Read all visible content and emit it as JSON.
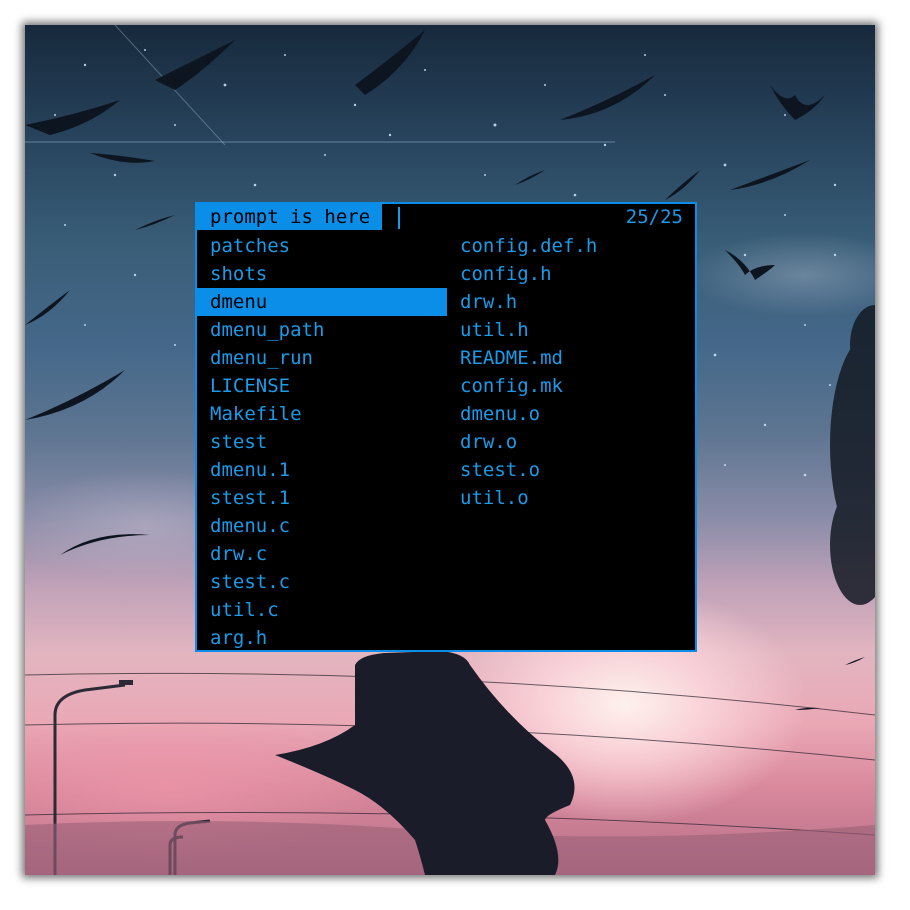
{
  "dmenu": {
    "prompt": "prompt is here",
    "input_value": "",
    "match_count": "25/25",
    "items_left": [
      "patches",
      "shots",
      "dmenu",
      "dmenu_path",
      "dmenu_run",
      "LICENSE",
      "Makefile",
      "stest",
      "dmenu.1",
      "stest.1",
      "dmenu.c",
      "drw.c",
      "stest.c",
      "util.c",
      "arg.h"
    ],
    "items_right": [
      "config.def.h",
      "config.h",
      "drw.h",
      "util.h",
      "README.md",
      "config.mk",
      "dmenu.o",
      "drw.o",
      "stest.o",
      "util.o"
    ],
    "selected_item": "dmenu"
  },
  "colors": {
    "menu_background": "#000000",
    "menu_foreground": "#1a9be9",
    "selection_background": "#0a8ee8",
    "selection_foreground": "#000000",
    "border": "#0a8ee8"
  },
  "wallpaper": {
    "icon": "wallpaper-anime-sky-icon"
  }
}
